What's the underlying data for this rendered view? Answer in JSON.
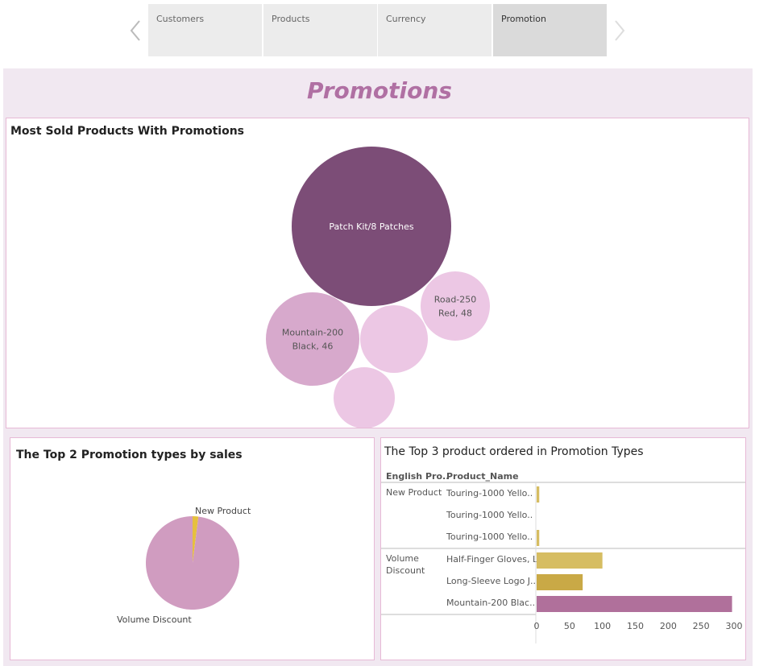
{
  "nav": {
    "tabs": [
      "Customers",
      "Products",
      "Currency",
      "Promotion"
    ],
    "active_tab": 3
  },
  "dashboard": {
    "title": "Promotions"
  },
  "colors": {
    "bubble_dark": "#7c4d77",
    "bubble_mid": "#d7a9cc",
    "bubble_light": "#ecc7e4",
    "pie_main": "#d09cc0",
    "pie_small": "#e6c03e",
    "bar_gold": "#d6bd62",
    "bar_purple": "#b0709b"
  },
  "bubble_panel": {
    "title": "Most Sold Products With Promotions",
    "chart_data": {
      "type": "bubble",
      "title": "Most Sold Products With Promotions",
      "bubbles": [
        {
          "label_lines": [
            "Patch Kit/8 Patches"
          ],
          "value": null,
          "shade": "dark"
        },
        {
          "label_lines": [
            "Mountain-200",
            "Black, 46"
          ],
          "value": 46,
          "shade": "mid"
        },
        {
          "label_lines": [
            "Road-250",
            "Red, 48"
          ],
          "value": 48,
          "shade": "light"
        },
        {
          "label_lines": [],
          "value": null,
          "shade": "light"
        },
        {
          "label_lines": [],
          "value": null,
          "shade": "light"
        }
      ]
    }
  },
  "pie_panel": {
    "title": "The Top 2 Promotion types by sales",
    "chart_data": {
      "type": "pie",
      "title": "The Top 2 Promotion types by sales",
      "slices": [
        {
          "label": "Volume Discount",
          "share": 0.98
        },
        {
          "label": "New Product",
          "share": 0.02
        }
      ]
    }
  },
  "bar_panel": {
    "title": "The Top 3 product ordered in Promotion Types",
    "col_headers": [
      "English Pro..",
      "Product_Name"
    ],
    "axis_ticks": [
      "0",
      "50",
      "100",
      "150",
      "200",
      "250",
      "300"
    ],
    "chart_data": {
      "type": "bar",
      "orientation": "horizontal",
      "title": "The Top 3 product ordered in Promotion Types",
      "xlim": [
        0,
        300
      ],
      "groups": [
        {
          "name": "New Product",
          "name_lines": [
            "New Product"
          ],
          "rows": [
            {
              "product": "Touring-1000 Yello..",
              "value": 4
            },
            {
              "product": "Touring-1000 Yello..",
              "value": 0
            },
            {
              "product": "Touring-1000 Yello..",
              "value": 4
            }
          ]
        },
        {
          "name": "Volume Discount",
          "name_lines": [
            "Volume",
            "Discount"
          ],
          "rows": [
            {
              "product": "Half-Finger Gloves, L",
              "value": 100
            },
            {
              "product": "Long-Sleeve Logo J..",
              "value": 70
            },
            {
              "product": "Mountain-200 Blac..",
              "value": 297
            }
          ]
        }
      ]
    }
  }
}
